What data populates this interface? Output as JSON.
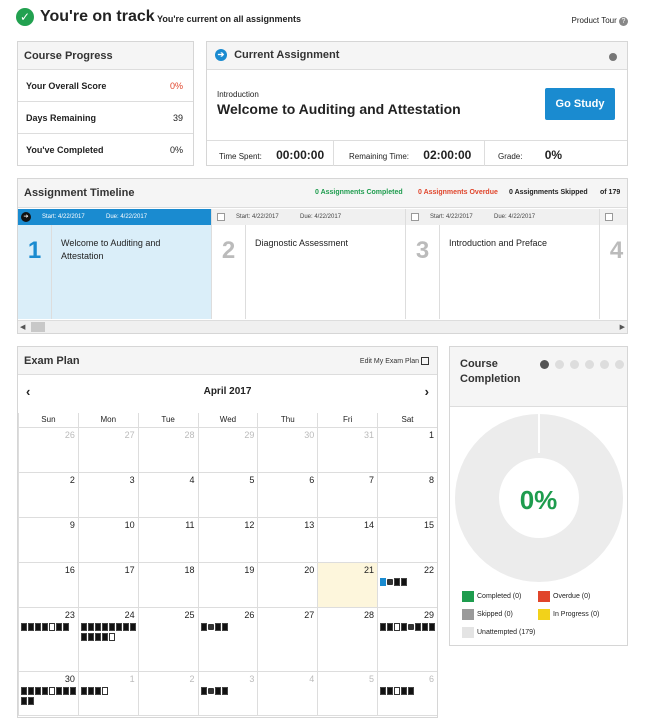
{
  "header": {
    "title": "You're on track",
    "subtitle": "You're current on all assignments",
    "tour": "Product Tour"
  },
  "progress": {
    "title": "Course Progress",
    "rows": [
      {
        "label": "Your Overall Score",
        "value": "0%",
        "color": "#e0452b"
      },
      {
        "label": "Days Remaining",
        "value": "39",
        "color": "#222"
      },
      {
        "label": "You've Completed",
        "value": "0%",
        "color": "#222"
      }
    ]
  },
  "current": {
    "title": "Current Assignment",
    "section": "Introduction",
    "name": "Welcome to Auditing and Attestation",
    "button": "Go Study",
    "time_spent_label": "Time Spent:",
    "time_spent": "00:00:00",
    "remaining_label": "Remaining Time:",
    "remaining": "02:00:00",
    "grade_label": "Grade:",
    "grade": "0%"
  },
  "timeline": {
    "title": "Assignment Timeline",
    "completed": "0 Assignments Completed",
    "overdue": "0 Assignments Overdue",
    "skipped": "0 Assignments Skipped",
    "total": "of 179",
    "items": [
      {
        "num": "1",
        "start": "Start: 4/22/2017",
        "due": "Due: 4/22/2017",
        "name": "Welcome to Auditing and Attestation"
      },
      {
        "num": "2",
        "start": "Start: 4/22/2017",
        "due": "Due: 4/22/2017",
        "name": "Diagnostic Assessment"
      },
      {
        "num": "3",
        "start": "Start: 4/22/2017",
        "due": "Due: 4/22/2017",
        "name": "Introduction and Preface"
      },
      {
        "num": "4",
        "start": "",
        "due": "",
        "name": ""
      }
    ]
  },
  "exam": {
    "title": "Exam Plan",
    "edit": "Edit My Exam Plan",
    "month": "April 2017",
    "days": [
      "Sun",
      "Mon",
      "Tue",
      "Wed",
      "Thu",
      "Fri",
      "Sat"
    ],
    "weeks": [
      [
        "26",
        "27",
        "28",
        "29",
        "30",
        "31",
        "1"
      ],
      [
        "2",
        "3",
        "4",
        "5",
        "6",
        "7",
        "8"
      ],
      [
        "9",
        "10",
        "11",
        "12",
        "13",
        "14",
        "15"
      ],
      [
        "16",
        "17",
        "18",
        "19",
        "20",
        "21",
        "22"
      ],
      [
        "23",
        "24",
        "25",
        "26",
        "27",
        "28",
        "29"
      ],
      [
        "30",
        "1",
        "2",
        "3",
        "4",
        "5",
        "6"
      ]
    ]
  },
  "completion": {
    "title": "Course Completion",
    "percent": "0%",
    "legend": [
      "Completed (0)",
      "Overdue (0)",
      "Skipped (0)",
      "In Progress (0)",
      "Unattempted (179)"
    ],
    "colors": [
      "#1e9c4e",
      "#e0452b",
      "#9a9a9a",
      "#f2d21a",
      "#e4e4e4"
    ]
  }
}
